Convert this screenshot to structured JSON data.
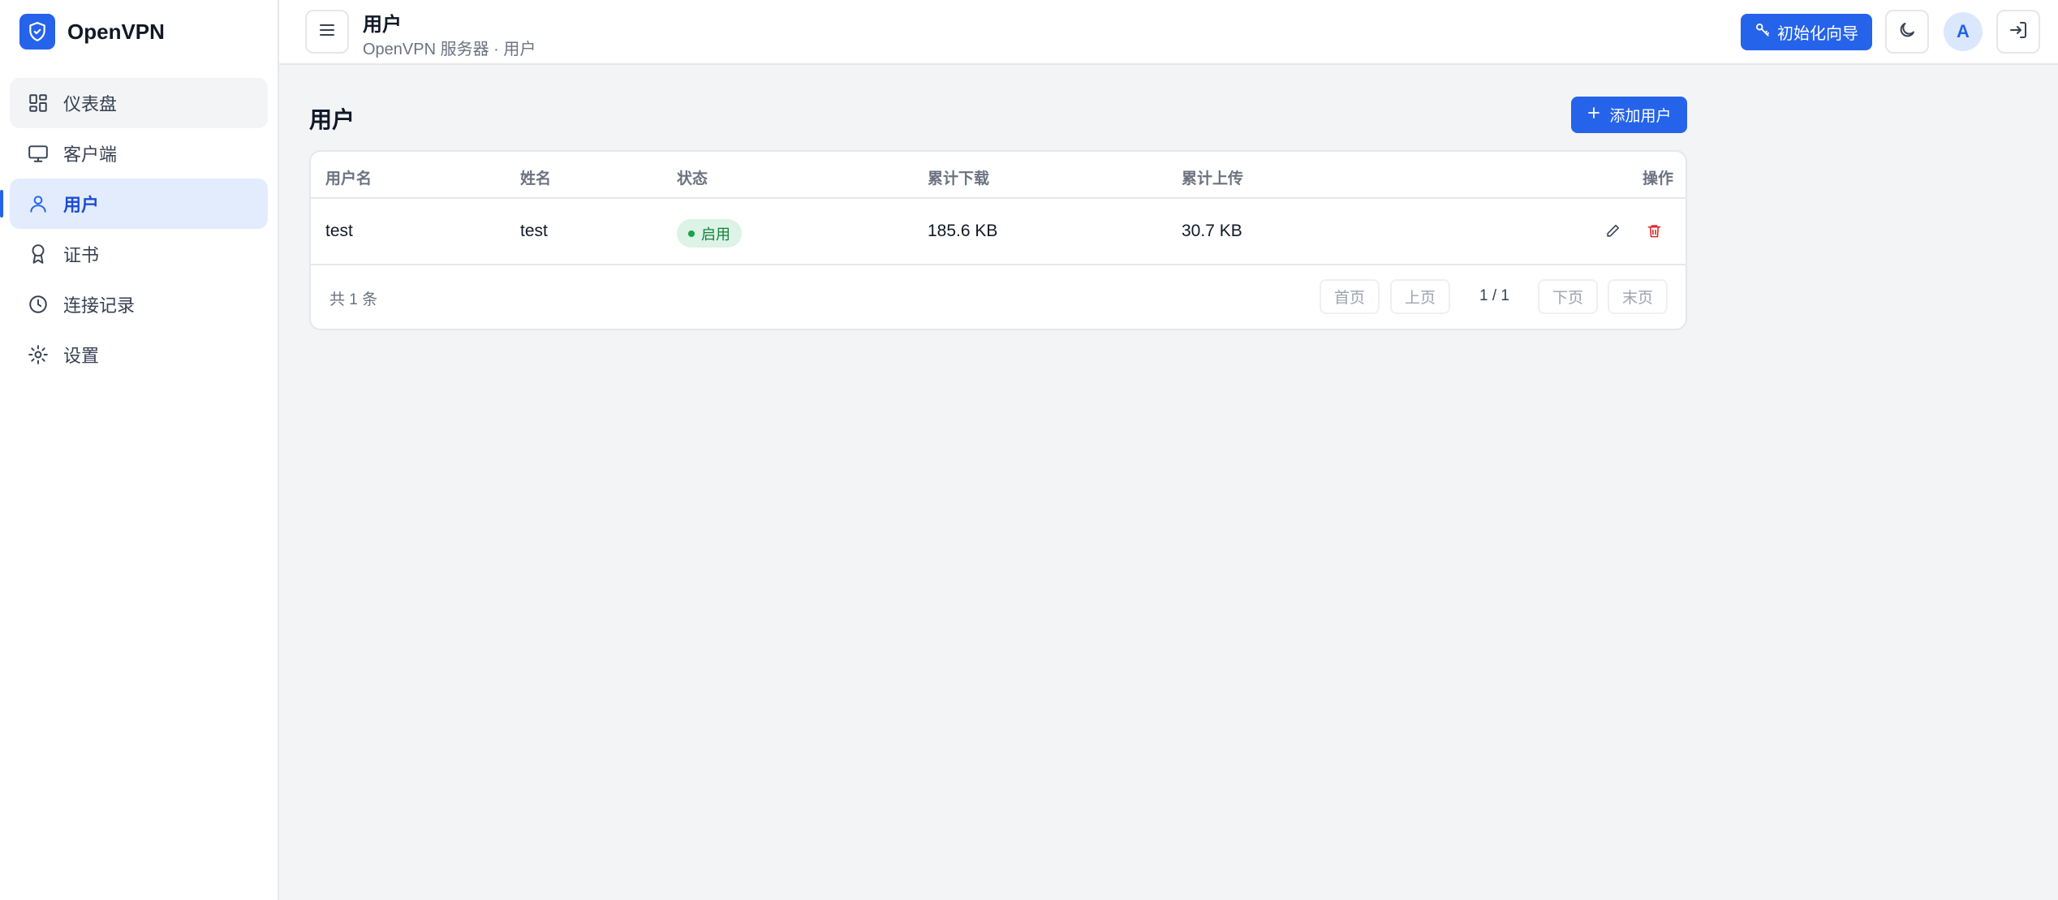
{
  "brand": {
    "name": "OpenVPN"
  },
  "sidebar": {
    "items": [
      {
        "label": "仪表盘",
        "icon": "dashboard-icon"
      },
      {
        "label": "客户端",
        "icon": "monitor-icon"
      },
      {
        "label": "用户",
        "icon": "user-icon"
      },
      {
        "label": "证书",
        "icon": "award-icon"
      },
      {
        "label": "连接记录",
        "icon": "clock-icon"
      },
      {
        "label": "设置",
        "icon": "gear-icon"
      }
    ],
    "active_index": 2
  },
  "header": {
    "title": "用户",
    "subtitle": "OpenVPN 服务器 · 用户",
    "wizard_label": "初始化向导",
    "avatar_letter": "A"
  },
  "main": {
    "title": "用户",
    "add_button": "添加用户",
    "table": {
      "columns": [
        "用户名",
        "姓名",
        "状态",
        "累计下载",
        "累计上传",
        "操作"
      ],
      "rows": [
        {
          "username": "test",
          "name": "test",
          "status": "启用",
          "download": "185.6 KB",
          "upload": "30.7 KB"
        }
      ]
    },
    "pagination": {
      "total_text": "共 1 条",
      "first": "首页",
      "prev": "上页",
      "info": "1 / 1",
      "next": "下页",
      "last": "末页"
    }
  },
  "colors": {
    "primary": "#2563eb",
    "active_bg": "#e3ecfd",
    "status_enabled": "#15803d",
    "delete": "#dc2626"
  }
}
